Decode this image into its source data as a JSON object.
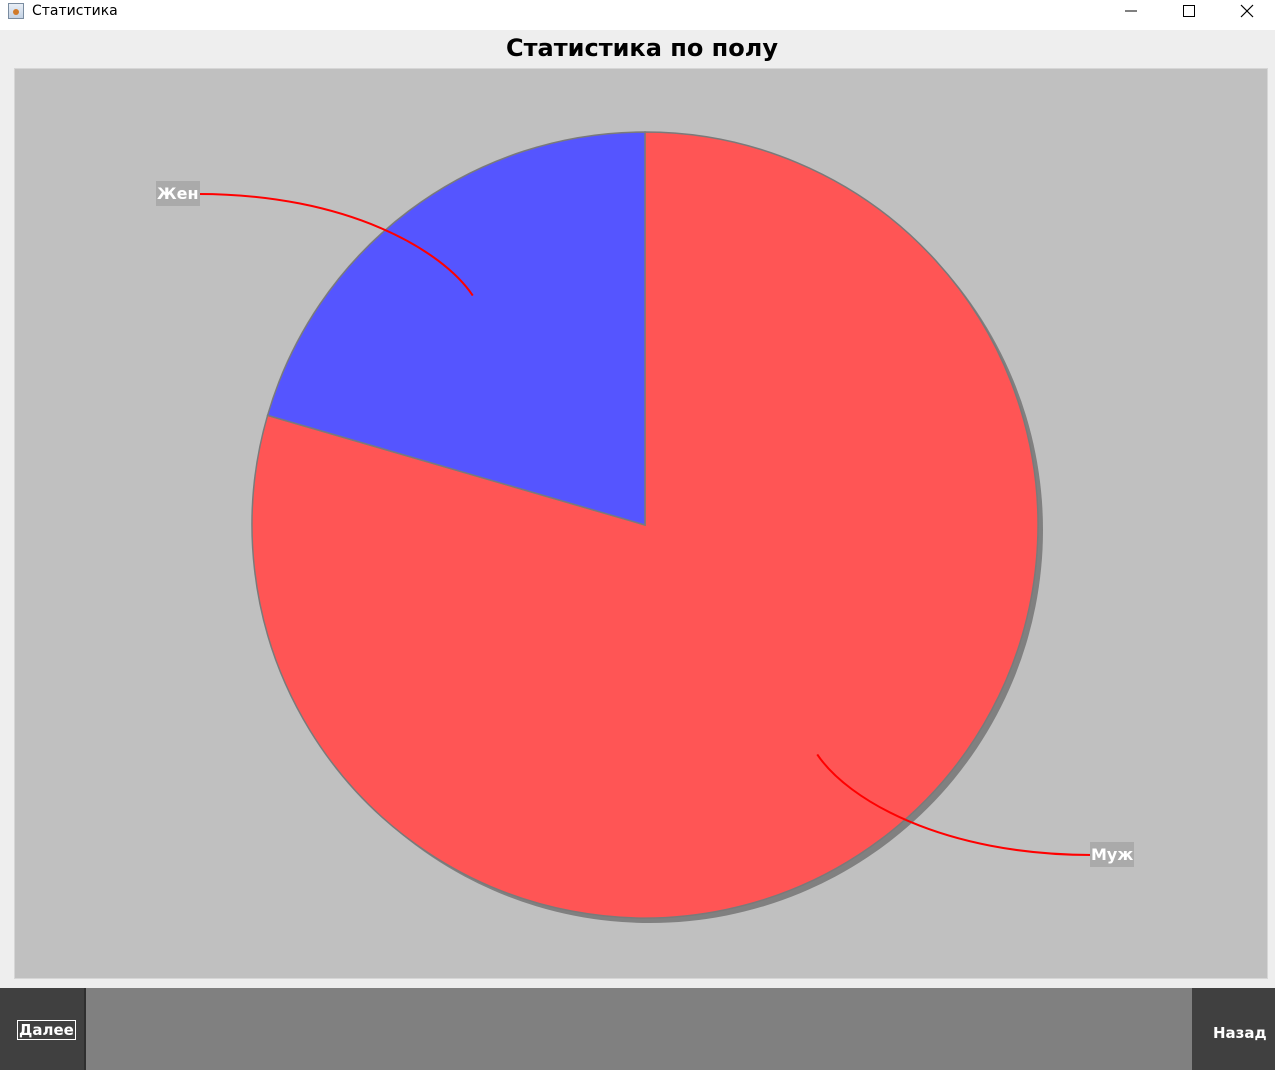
{
  "window": {
    "title": "Статистика"
  },
  "colors": {
    "plot_background": "#c0c0c0",
    "label_line": "#ff0000",
    "label_box": "#aaaaaa",
    "shadow": "#808080"
  },
  "chart_data": {
    "type": "pie",
    "title": "Статистика по полу",
    "start_angle_deg": 90,
    "direction": "clockwise",
    "slices": [
      {
        "label": "Муж",
        "value": 79.5,
        "color": "#ff5555"
      },
      {
        "label": "Жен",
        "value": 20.5,
        "color": "#5555ff"
      }
    ],
    "shadow": true,
    "legend": "none"
  },
  "buttons": {
    "next_label": "Далее",
    "back_label": "Назад"
  }
}
